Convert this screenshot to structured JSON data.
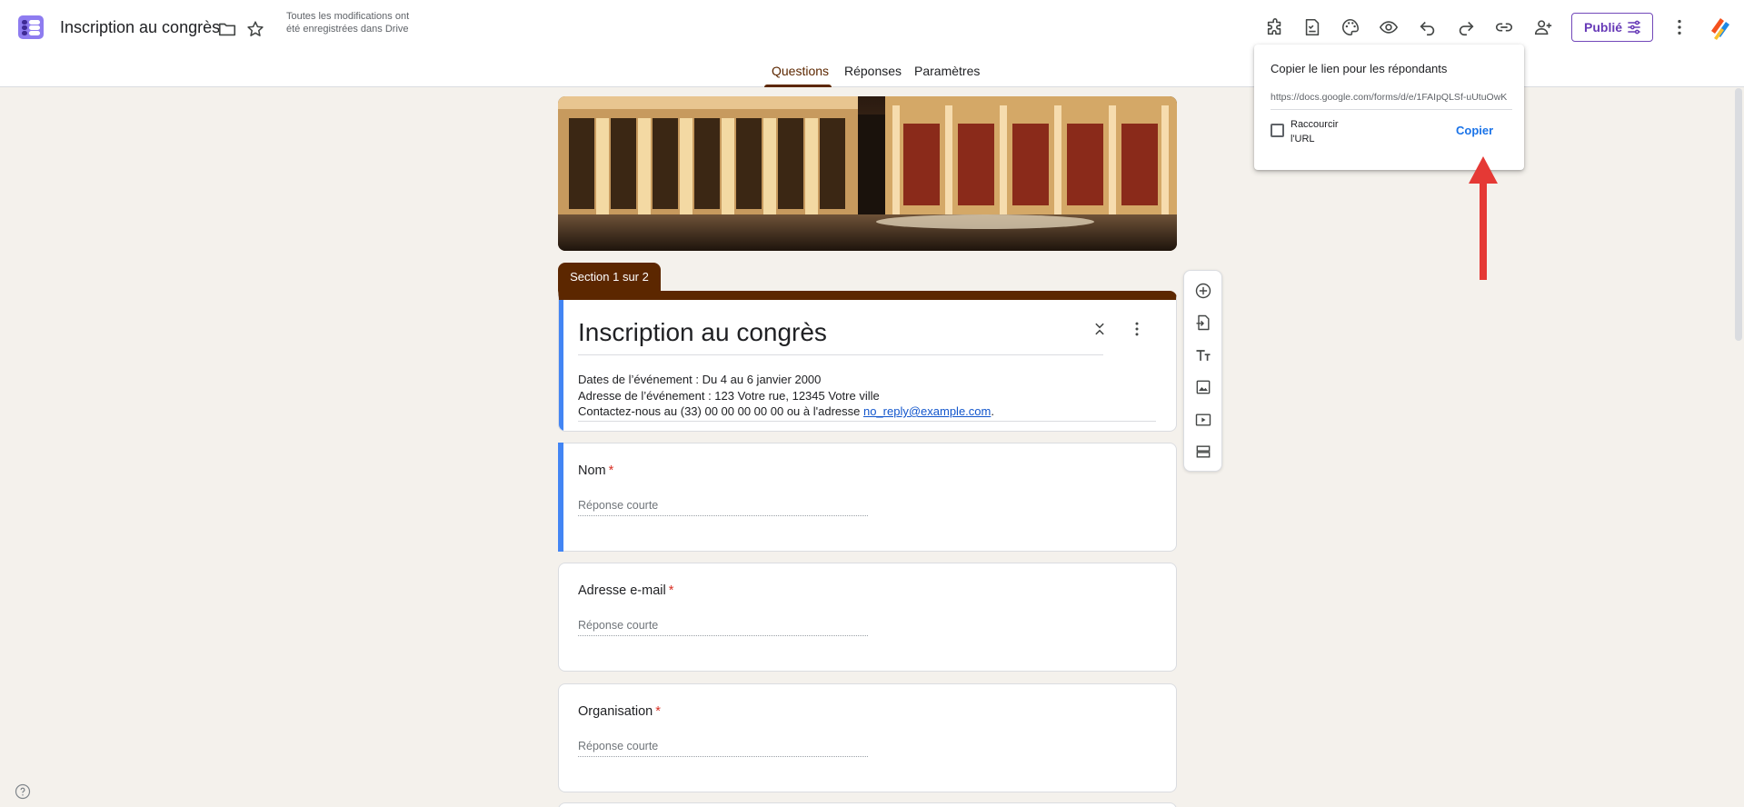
{
  "header": {
    "title": "Inscription au congrès",
    "save_status": "Toutes les modifications ont été enregistrées dans Drive",
    "publish_label": "Publié",
    "toolbar_icons": [
      "addons-icon",
      "checklist-icon",
      "palette-icon",
      "preview-icon",
      "undo-icon",
      "redo-icon",
      "link-icon",
      "add-person-icon",
      "more-vert-icon"
    ]
  },
  "tabs": [
    {
      "label": "Questions",
      "active": true
    },
    {
      "label": "Réponses",
      "active": false
    },
    {
      "label": "Paramètres",
      "active": false
    }
  ],
  "popup": {
    "title": "Copier le lien pour les répondants",
    "url": "https://docs.google.com/forms/d/e/1FAIpQLSf-uUtuOwK",
    "shorten_label": "Raccourcir l'URL",
    "shorten_checked": false,
    "copy_label": "Copier"
  },
  "form": {
    "section_label": "Section 1 sur 2",
    "title": "Inscription au congrès",
    "description": {
      "line1": "Dates de l’événement : Du 4 au 6 janvier 2000",
      "line2": "Adresse de l’événement : 123 Votre rue, 12345 Votre ville",
      "line3_prefix": "Contactez-nous au (33) 00 00 00 00 00 ou à l'adresse ",
      "email": "no_reply@example.com",
      "line3_suffix": "."
    },
    "questions": [
      {
        "label": "Nom",
        "required_mark": "*",
        "placeholder": "Réponse courte"
      },
      {
        "label": "Adresse e-mail",
        "required_mark": "*",
        "placeholder": "Réponse courte"
      },
      {
        "label": "Organisation",
        "required_mark": "*",
        "placeholder": "Réponse courte"
      }
    ]
  },
  "side_toolbar": [
    "add-question-icon",
    "import-questions-icon",
    "add-title-icon",
    "add-image-icon",
    "add-video-icon",
    "add-section-icon"
  ],
  "colors": {
    "theme": "#5c2700",
    "accent": "#673ab7",
    "link": "#1a73e8",
    "focus": "#4285f4",
    "required": "#d93025",
    "background": "#f4f1ec",
    "annotation_arrow": "#e53935"
  }
}
